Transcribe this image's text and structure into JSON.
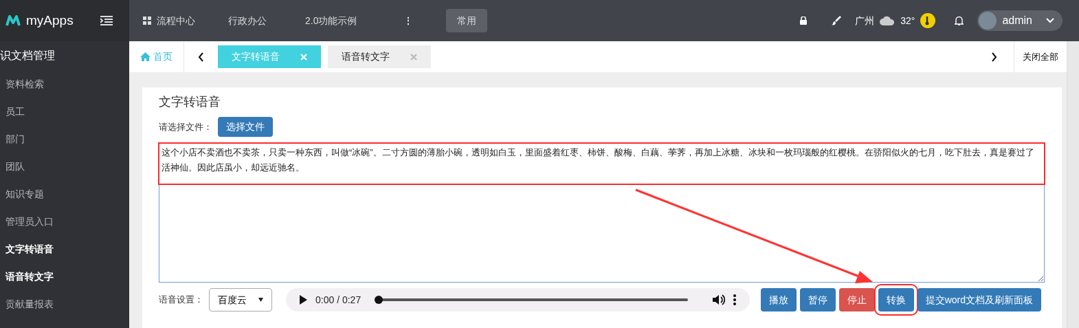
{
  "brand": {
    "name": "myApps"
  },
  "top_nav": [
    {
      "label": "流程中心",
      "kind": "grid"
    },
    {
      "label": "行政办公",
      "kind": "plain"
    },
    {
      "label": "2.0功能示例",
      "kind": "plain"
    }
  ],
  "top_nav_more": "⋮",
  "quick_button": "常用",
  "weather": {
    "city": "广州",
    "temp": "32°"
  },
  "user": {
    "name": "admin"
  },
  "sidebar": {
    "title": "识文档管理",
    "items": [
      {
        "label": "资料检索",
        "selected": false
      },
      {
        "label": "员工",
        "selected": false
      },
      {
        "label": "部门",
        "selected": false
      },
      {
        "label": "团队",
        "selected": false
      },
      {
        "label": "知识专题",
        "selected": false
      },
      {
        "label": "管理员入口",
        "selected": false
      },
      {
        "label": "文字转语音",
        "selected": true
      },
      {
        "label": "语音转文字",
        "selected": true
      },
      {
        "label": "贡献量报表",
        "selected": false
      }
    ]
  },
  "home_tab": "首页",
  "tabs": [
    {
      "label": "文字转语音",
      "selected": true
    },
    {
      "label": "语音转文字",
      "selected": false
    }
  ],
  "close_all": "关闭全部",
  "panel": {
    "title": "文字转语音",
    "file_label": "请选择文件：",
    "file_button": "选择文件",
    "text": "这个小店不卖酒也不卖茶，只卖一种东西，叫做“冰碗”。二寸方圆的薄胎小碗，透明如白玉，里面盛着红枣、柿饼、酸梅、白藕、荸荠，再加上冰糖、冰块和一枚玛瑙般的红樱桃。在骄阳似火的七月，吃下肚去，真是赛过了活神仙。因此店虽小，却远近驰名。",
    "voice_label": "语音设置：",
    "voice_value": "百度云",
    "player": {
      "time": "0:00 / 0:27",
      "level": 0
    },
    "buttons": [
      {
        "label": "播放",
        "kind": "primary"
      },
      {
        "label": "暂停",
        "kind": "primary"
      },
      {
        "label": "停止",
        "kind": "danger"
      },
      {
        "label": "转换",
        "kind": "primary",
        "highlighted": true
      },
      {
        "label": "提交word文档及刷新面板",
        "kind": "primary"
      }
    ]
  }
}
